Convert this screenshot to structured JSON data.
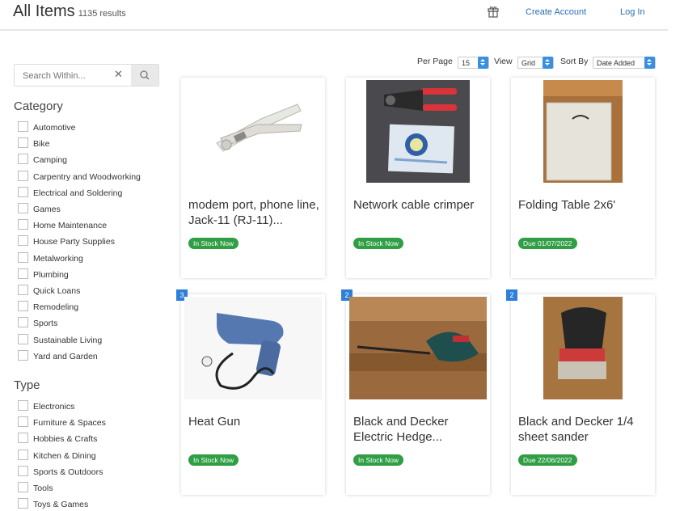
{
  "header": {
    "title": "All Items",
    "result_count": "1135 results",
    "create_account": "Create Account",
    "log_in": "Log In"
  },
  "search": {
    "placeholder": "Search Within..."
  },
  "filters": {
    "category": {
      "heading": "Category",
      "items": [
        "Automotive",
        "Bike",
        "Camping",
        "Carpentry and Woodworking",
        "Electrical and Soldering",
        "Games",
        "Home Maintenance",
        "House Party Supplies",
        "Metalworking",
        "Plumbing",
        "Quick Loans",
        "Remodeling",
        "Sports",
        "Sustainable Living",
        "Yard and Garden"
      ]
    },
    "type": {
      "heading": "Type",
      "items": [
        "Electronics",
        "Furniture & Spaces",
        "Hobbies & Crafts",
        "Kitchen & Dining",
        "Sports & Outdoors",
        "Tools",
        "Toys & Games"
      ]
    }
  },
  "controls": {
    "per_page_label": "Per Page",
    "per_page_value": "15",
    "view_label": "View",
    "view_value": "Grid",
    "sort_label": "Sort By",
    "sort_value": "Date Added"
  },
  "colors": {
    "accent": "#2a6fb5",
    "badge_green": "#2f9e44",
    "badge_blue": "#2f7fd8"
  },
  "items": [
    {
      "title": "modem port, phone line, Jack-11 (RJ-11)...",
      "status": "In Stock Now",
      "image": "crimper-tool"
    },
    {
      "title": "Network cable crimper",
      "status": "In Stock Now",
      "image": "red-handle-crimper"
    },
    {
      "title": "Folding Table 2x6'",
      "status": "Due 01/07/2022",
      "image": "folding-table"
    },
    {
      "title": "Heat Gun",
      "status": "In Stock Now",
      "qty": "3",
      "image": "heat-gun"
    },
    {
      "title": "Black and Decker Electric Hedge...",
      "status": "In Stock Now",
      "qty": "2",
      "image": "hedge-trimmer"
    },
    {
      "title": "Black and Decker 1/4 sheet sander",
      "status": "Due 22/06/2022",
      "qty": "2",
      "image": "sheet-sander"
    }
  ]
}
